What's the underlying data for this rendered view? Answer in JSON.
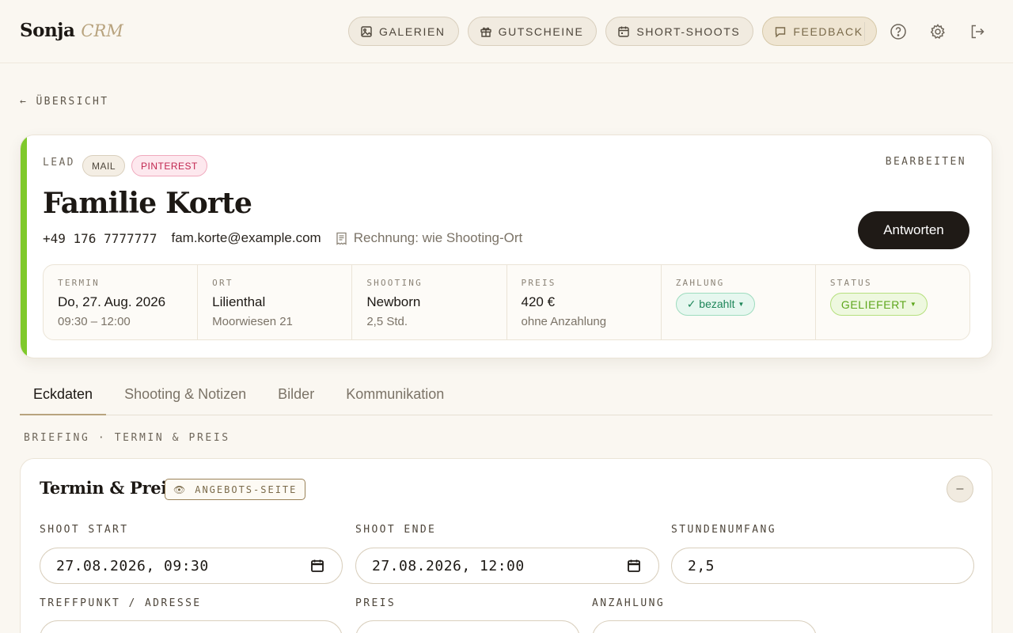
{
  "header": {
    "logo_main": "Sonja",
    "logo_sub": "CRM",
    "nav": [
      {
        "label": "GALERIEN",
        "icon": "image-icon"
      },
      {
        "label": "GUTSCHEINE",
        "icon": "gift-icon"
      },
      {
        "label": "SHORT-SHOOTS",
        "icon": "calendar-icon"
      },
      {
        "label": "FEEDBACK",
        "icon": "chat-icon"
      }
    ],
    "icons": [
      "help-icon",
      "settings-gear-icon",
      "logout-icon"
    ]
  },
  "back_label": "← ÜBERSICHT",
  "lead": {
    "type_label": "LEAD",
    "tags": [
      "MAIL",
      "PINTEREST"
    ],
    "edit_label": "BEARBEITEN",
    "name": "Familie Korte",
    "phone": "+49 176 7777777",
    "email": "fam.korte@example.com",
    "billing": "Rechnung: wie Shooting-Ort",
    "reply_label": "Antworten",
    "accent_color": "#7fc92b",
    "facts": {
      "termin": {
        "label": "TERMIN",
        "value": "Do, 27. Aug. 2026",
        "sub": "09:30 – 12:00"
      },
      "ort": {
        "label": "ORT",
        "value": "Lilienthal",
        "sub": "Moorwiesen 21"
      },
      "shooting": {
        "label": "SHOOTING",
        "value": "Newborn",
        "sub": "2,5 Std."
      },
      "preis": {
        "label": "PREIS",
        "value": "420 €",
        "sub": "ohne Anzahlung"
      },
      "zahlung": {
        "label": "ZAHLUNG",
        "value": "✓ bezahlt"
      },
      "status": {
        "label": "STATUS",
        "value": "GELIEFERT"
      }
    }
  },
  "tabs": [
    "Eckdaten",
    "Shooting & Notizen",
    "Bilder",
    "Kommunikation"
  ],
  "active_tab": "Eckdaten",
  "section_kicker": "BRIEFING · TERMIN & PREIS",
  "form": {
    "title": "Termin & Preis",
    "tag": "ANGEBOTS-SEITE",
    "collapse_label": "–",
    "fields": {
      "shoot_start": {
        "label": "SHOOT START",
        "value": "27.08.2026, 09:30"
      },
      "shoot_ende": {
        "label": "SHOOT ENDE",
        "value": "27.08.2026, 12:00"
      },
      "stundenumfang": {
        "label": "STUNDENUMFANG",
        "value": "2,5"
      },
      "treffpunkt": {
        "label": "TREFFPUNKT / ADRESSE"
      },
      "preis": {
        "label": "PREIS"
      },
      "anzahlung": {
        "label": "ANZAHLUNG"
      }
    }
  }
}
